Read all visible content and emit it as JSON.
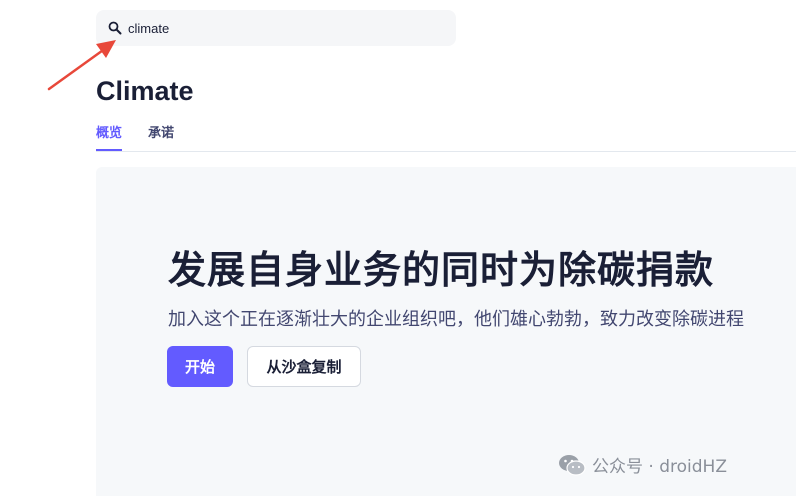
{
  "search": {
    "value": "climate",
    "icon": "search-icon"
  },
  "page": {
    "title": "Climate"
  },
  "tabs": [
    {
      "label": "概览",
      "active": true
    },
    {
      "label": "承诺",
      "active": false
    }
  ],
  "hero": {
    "title": "发展自身业务的同时为除碳捐款",
    "subtitle": "加入这个正在逐渐壮大的企业组织吧，他们雄心勃勃，致力改变除碳进程",
    "primary_button": "开始",
    "secondary_button": "从沙盒复制"
  },
  "watermark": {
    "text": "公众号 · droidHZ",
    "icon": "wechat-icon"
  },
  "colors": {
    "accent": "#635bff",
    "annotation_arrow": "#e8483a",
    "panel_background": "#f6f8fa"
  }
}
